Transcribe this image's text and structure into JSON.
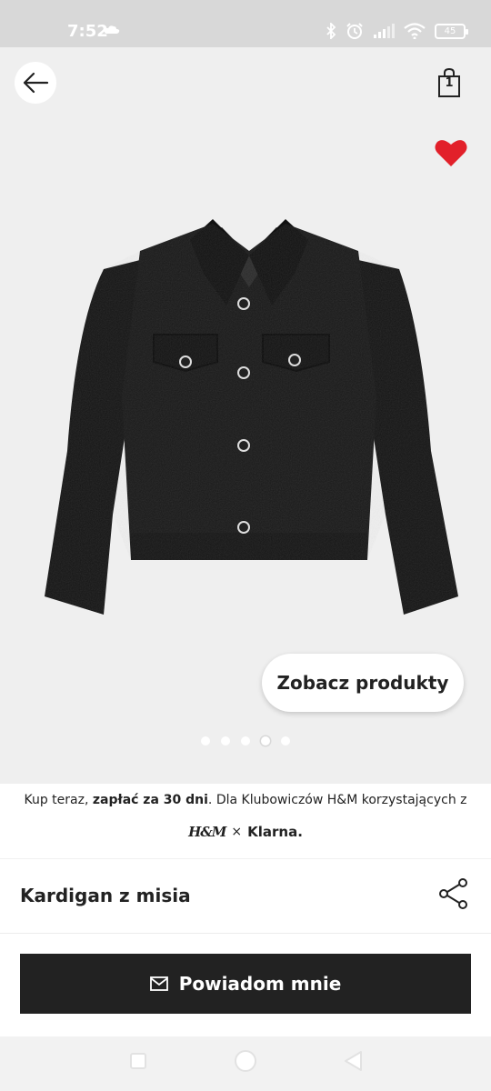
{
  "status_bar": {
    "time": "7:52",
    "battery": "45",
    "icons": [
      "cloud-icon",
      "bluetooth-icon",
      "alarm-icon",
      "signal-icon",
      "wifi-icon",
      "battery-icon"
    ]
  },
  "header": {
    "back_icon": "arrow-left-icon",
    "bag_count": "1",
    "bag_icon": "shopping-bag-icon",
    "favorite_icon": "heart-icon"
  },
  "gallery": {
    "product_image": "black-teddy-jacket",
    "see_products_label": "Zobacz produkty",
    "page_count": 5,
    "active_page": 4
  },
  "klarna": {
    "prefix": "Kup teraz, ",
    "bold": "zapłać za 30 dni",
    "suffix": ". Dla Klubowiczów H&M korzystających z",
    "hm_logo": "H&M",
    "times": "×",
    "klarna_logo": "Klarna."
  },
  "product": {
    "name": "Kardigan z misia",
    "share_icon": "share-icon"
  },
  "action": {
    "notify_label": "Powiadom mnie",
    "notify_icon": "mail-icon"
  },
  "colors": {
    "favorite": "#e2202a",
    "button_dark": "#222222"
  }
}
